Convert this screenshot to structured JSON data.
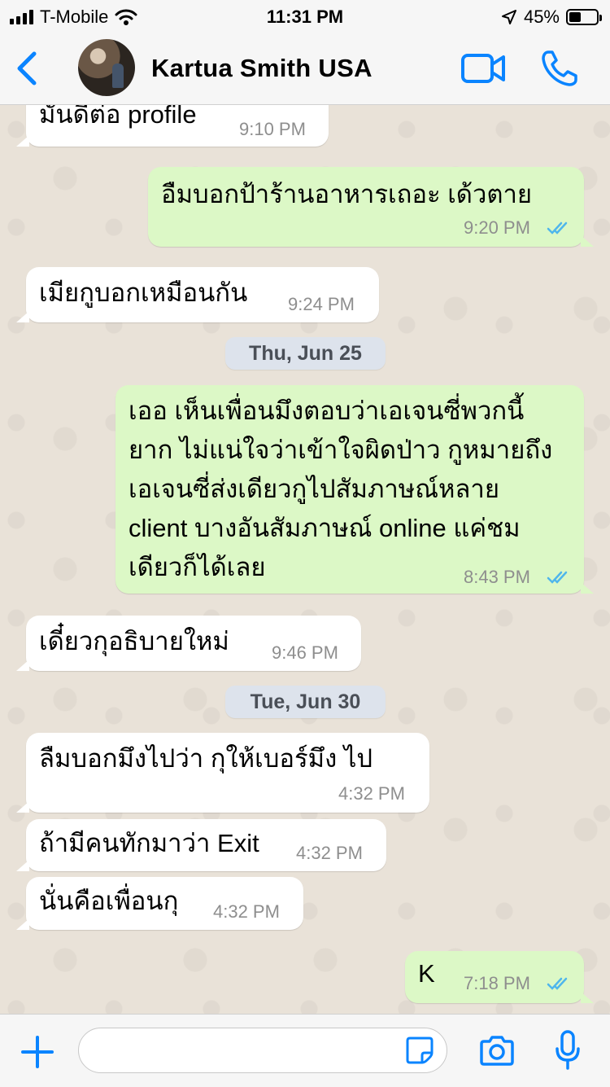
{
  "status_bar": {
    "carrier": "T-Mobile",
    "time": "11:31 PM",
    "battery": "45%",
    "battery_level": 0.45
  },
  "header": {
    "contact_name": "Kartua Smith USA"
  },
  "colors": {
    "accent": "#0a84ff",
    "outgoing_bubble": "#dcf8c6",
    "incoming_bubble": "#ffffff",
    "read_ticks": "#4fb6ec",
    "chat_background": "#e9e2d8"
  },
  "icons": [
    "back-chevron-icon",
    "video-call-icon",
    "phone-icon",
    "plus-icon",
    "sticker-icon",
    "camera-icon",
    "microphone-icon",
    "read-ticks-icon"
  ],
  "messages": [
    {
      "direction": "in",
      "text": "มันดีต่อ profile",
      "time": "9:10 PM"
    },
    {
      "direction": "out",
      "text": "อืมบอกป้าร้านอาหารเถอะ เด้วตาย",
      "time": "9:20 PM",
      "read": true
    },
    {
      "direction": "in",
      "text": "เมียกูบอกเหมือนกัน",
      "time": "9:24 PM"
    },
    {
      "type": "date",
      "text": "Thu, Jun 25"
    },
    {
      "direction": "out",
      "text": "เออ เห็นเพื่อนมึงตอบว่าเอเจนซี่พวกนี้\nยาก ไม่แน่ใจว่าเข้าใจผิดป่าว กูหมายถึง\nเอเจนซี่ส่งเดียวกูไปสัมภาษณ์หลาย\nclient บางอันสัมภาษณ์ online แค่ชม\nเดียวก็ได้เลย",
      "time": "8:43 PM",
      "read": true
    },
    {
      "direction": "in",
      "text": "เดี๋ยวกุอธิบายใหม่",
      "time": "9:46 PM"
    },
    {
      "type": "date",
      "text": "Tue, Jun 30"
    },
    {
      "direction": "in",
      "text": "ลืมบอกมึงไปว่า กุให้เบอร์มึง ไป",
      "time": "4:32 PM"
    },
    {
      "direction": "in",
      "text": "ถ้ามีคนทักมาว่า Exit",
      "time": "4:32 PM"
    },
    {
      "direction": "in",
      "text": "นั่นคือเพื่อนกุ",
      "time": "4:32 PM"
    },
    {
      "direction": "out",
      "text": "K",
      "time": "7:18 PM",
      "read": true
    }
  ],
  "input": {
    "value": "",
    "placeholder": ""
  }
}
